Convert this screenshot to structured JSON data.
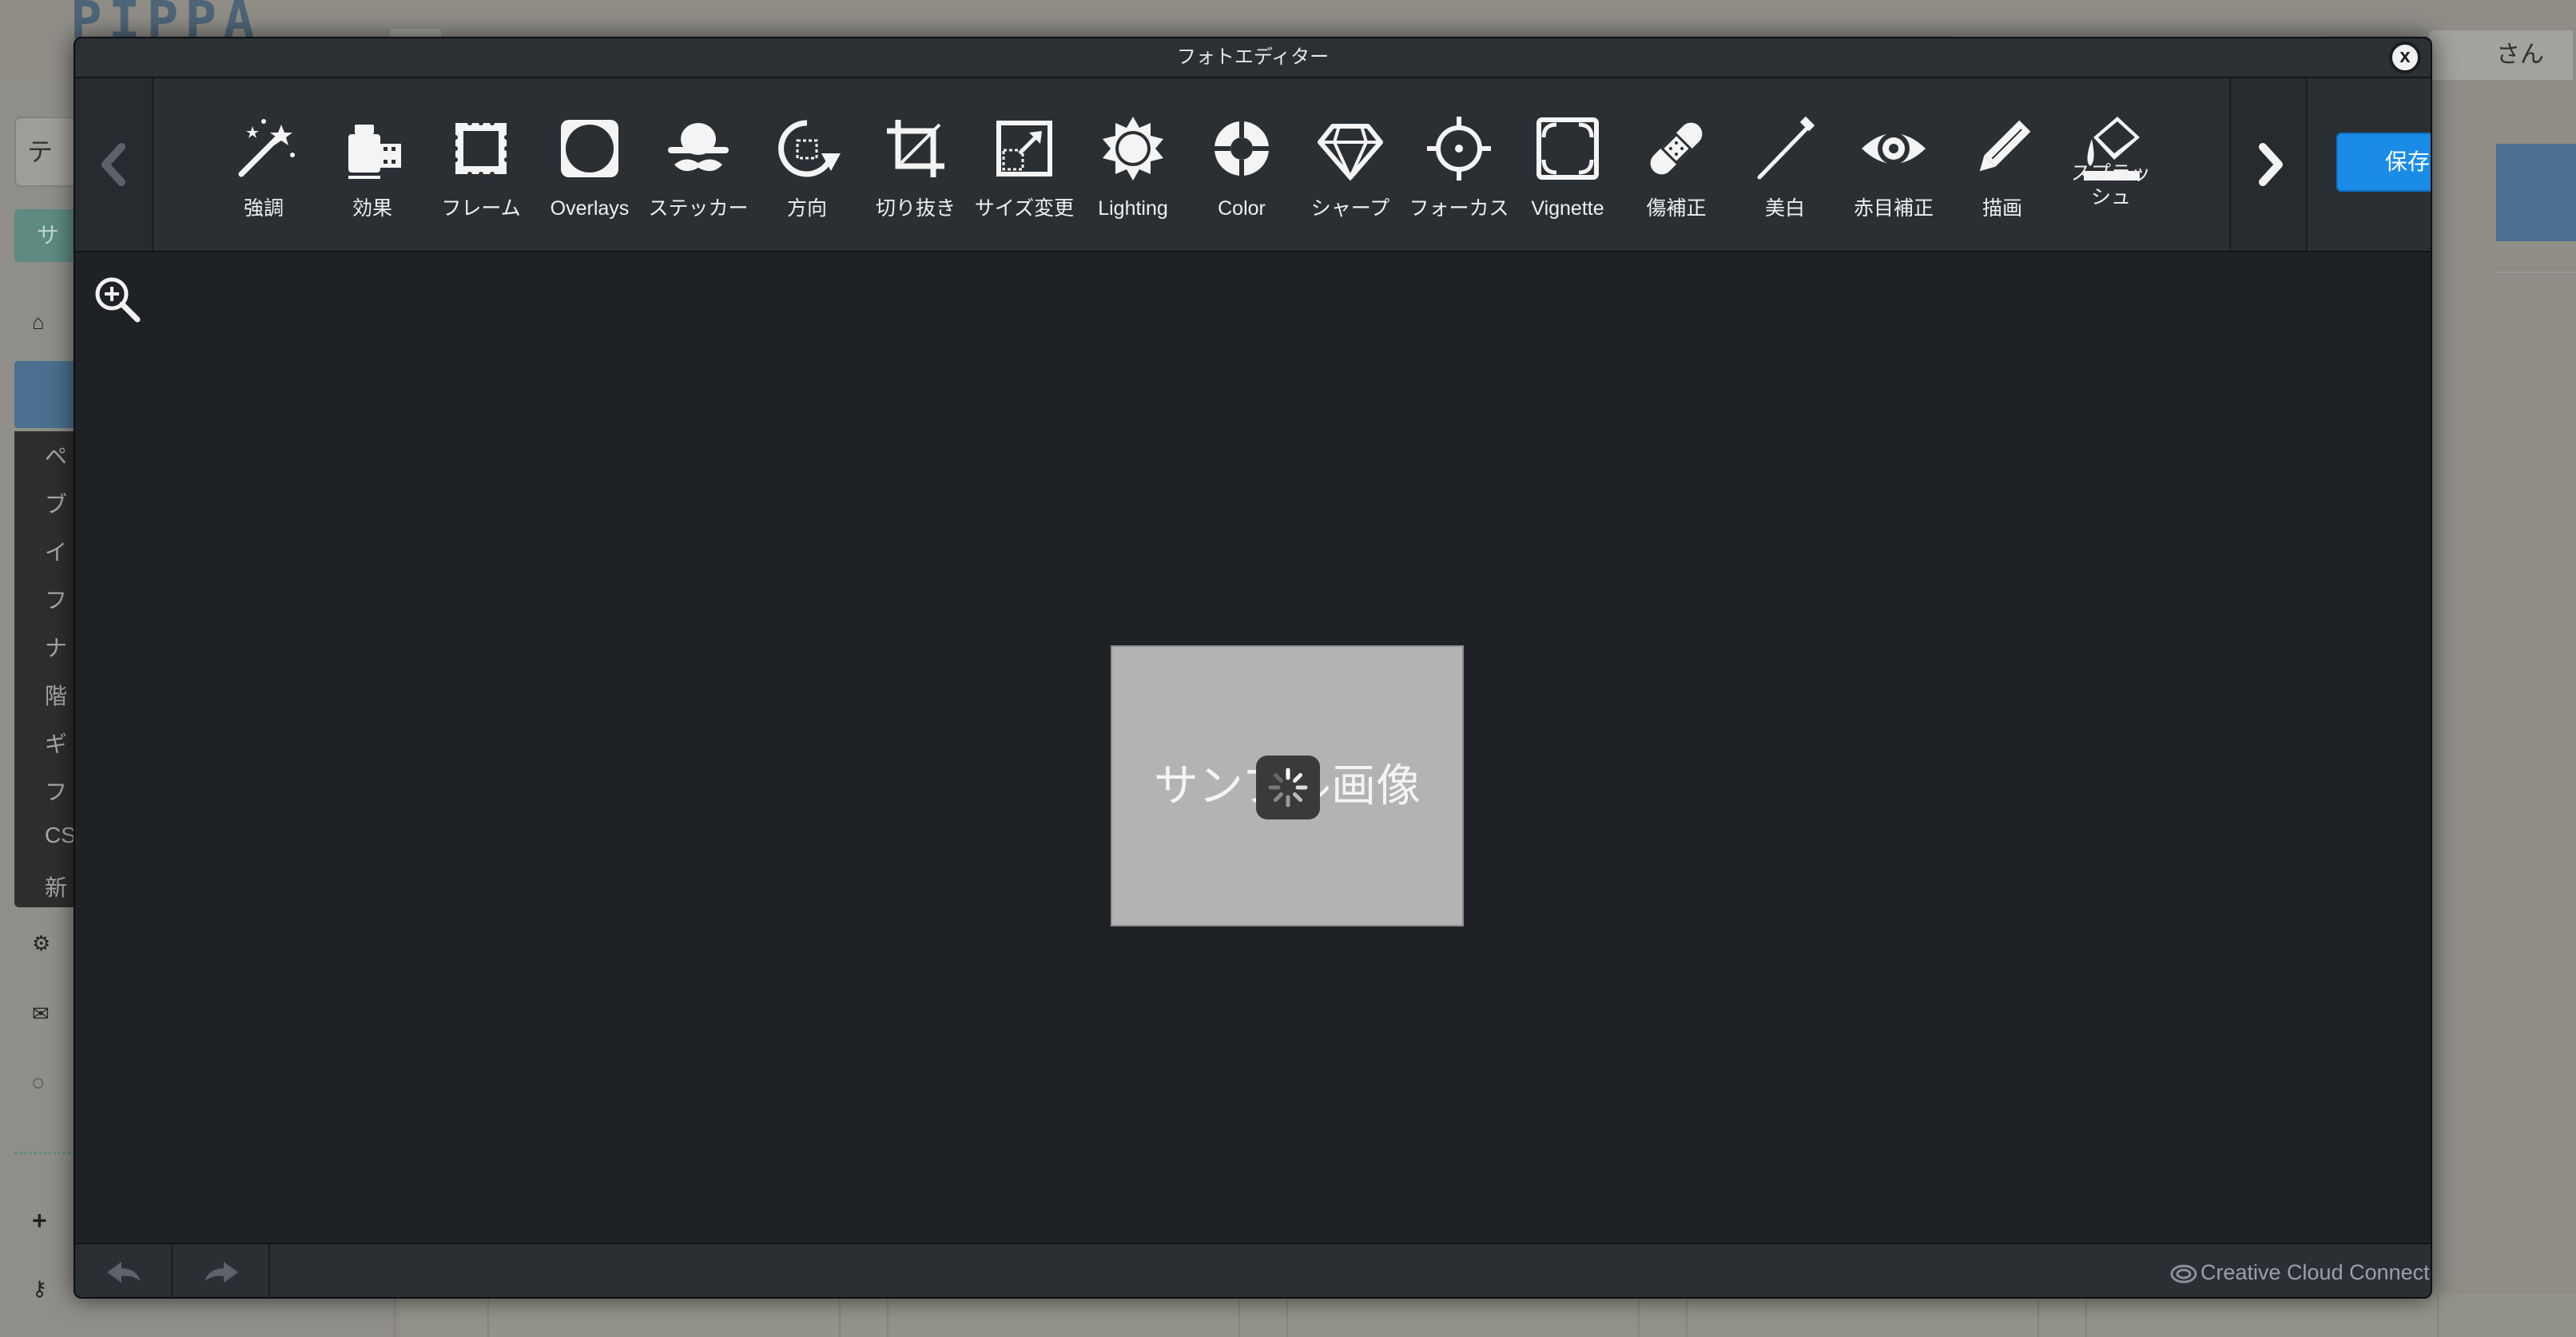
{
  "modal": {
    "title": "フォトエディター",
    "close_label": "x",
    "save_label": "保存",
    "tools": [
      {
        "label": "強調",
        "icon": "magic-wand-icon"
      },
      {
        "label": "効果",
        "icon": "film-canister-icon"
      },
      {
        "label": "フレーム",
        "icon": "frame-icon"
      },
      {
        "label": "Overlays",
        "icon": "circle-overlay-icon"
      },
      {
        "label": "ステッカー",
        "icon": "hat-mustache-icon"
      },
      {
        "label": "方向",
        "icon": "rotate-icon"
      },
      {
        "label": "切り抜き",
        "icon": "crop-icon"
      },
      {
        "label": "サイズ変更",
        "icon": "resize-icon"
      },
      {
        "label": "Lighting",
        "icon": "sun-icon"
      },
      {
        "label": "Color",
        "icon": "color-wheel-icon"
      },
      {
        "label": "シャープ",
        "icon": "diamond-icon"
      },
      {
        "label": "フォーカス",
        "icon": "crosshair-icon"
      },
      {
        "label": "Vignette",
        "icon": "vignette-icon"
      },
      {
        "label": "傷補正",
        "icon": "bandage-icon"
      },
      {
        "label": "美白",
        "icon": "toothbrush-icon"
      },
      {
        "label": "赤目補正",
        "icon": "eye-icon"
      },
      {
        "label": "描画",
        "icon": "pencil-icon"
      },
      {
        "label": "スプラッシュ",
        "icon": "paint-bucket-icon"
      }
    ],
    "image_text": "サンプル画像",
    "footer": {
      "cc_text": "Creative Cloud Connected"
    }
  },
  "background": {
    "logo": "PIPPA",
    "user_suffix": "さん",
    "search_value": "テス",
    "green_button": "サイ",
    "menu_items": [
      "ペ",
      "ブ",
      "イ",
      "フ",
      "ナ",
      "階",
      "ギ",
      "フ",
      "CS",
      "新"
    ]
  }
}
